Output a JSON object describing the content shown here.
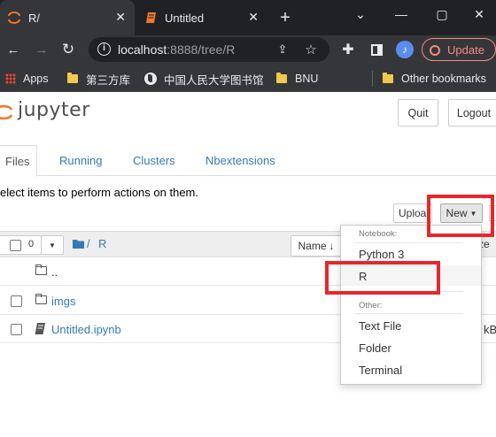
{
  "browser": {
    "tabs": [
      {
        "title": "R/",
        "active": true
      },
      {
        "title": "Untitled",
        "active": false
      }
    ],
    "url_host": "localhost",
    "url_rest": ":8888/tree/R",
    "update_label": "Update",
    "bookmarks": [
      "Apps",
      "第三方库",
      "中国人民大学图书馆",
      "BNU",
      "Other bookmarks"
    ],
    "colors": {
      "frame": "#202124",
      "toolbar": "#35363a",
      "update": "#f28b82"
    }
  },
  "jupyter": {
    "logo_text": "jupyter",
    "quit_label": "Quit",
    "logout_label": "Logout",
    "tabs": [
      "Files",
      "Running",
      "Clusters",
      "Nbextensions"
    ],
    "instruction": "elect items to perform actions on them.",
    "upload_label": "Uploa",
    "new_label": "New",
    "selected_count": "0",
    "breadcrumb_sep": "/",
    "breadcrumb_dir": "R",
    "sort_label": "Name",
    "size_col_fragment": "ze",
    "rows": [
      {
        "name": "..",
        "type": "parent"
      },
      {
        "name": "imgs",
        "type": "folder"
      },
      {
        "name": "Untitled.ipynb",
        "type": "notebook",
        "size_fragment": "kB"
      }
    ],
    "dropdown": {
      "notebook_header": "Notebook:",
      "notebook_items": [
        "Python 3",
        "R"
      ],
      "other_header": "Other:",
      "other_items": [
        "Text File",
        "Folder",
        "Terminal"
      ]
    },
    "colors": {
      "link": "#337ab7",
      "highlight_box": "#e8262d",
      "logo_orange": "#f37726"
    }
  }
}
